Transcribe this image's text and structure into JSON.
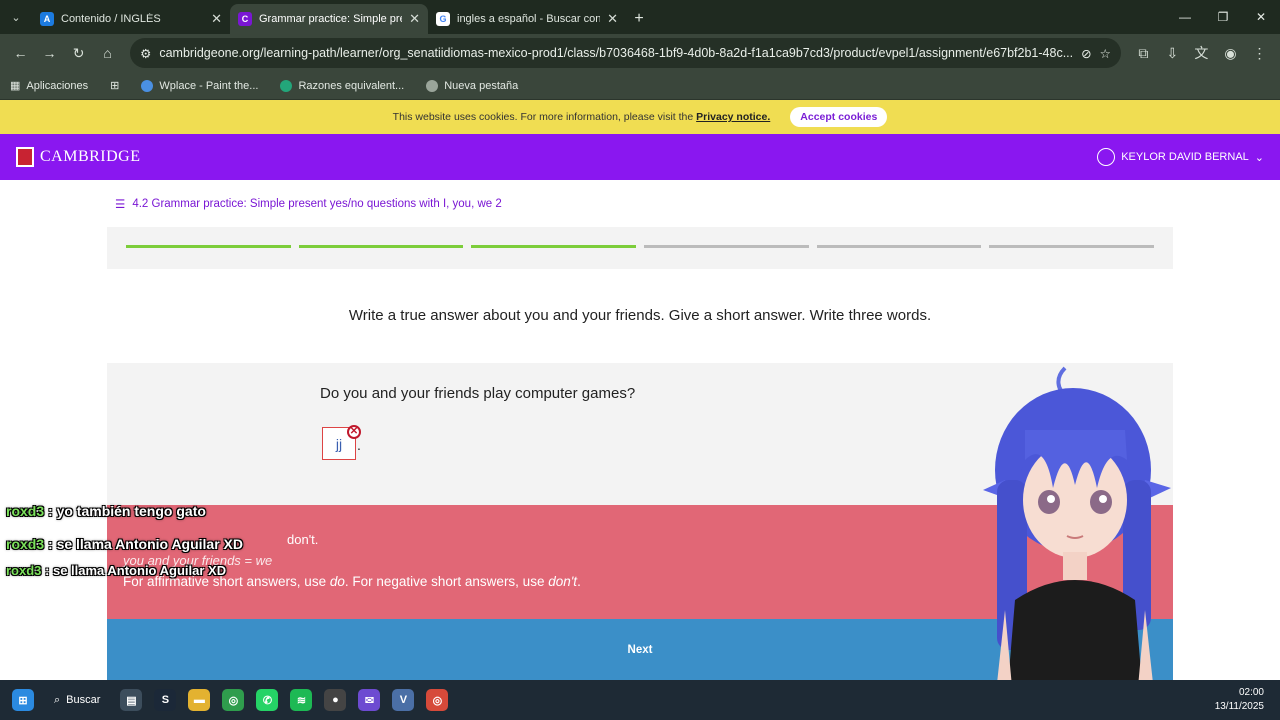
{
  "browser": {
    "tabs": [
      {
        "label": "Contenido / INGLÉS",
        "favicon": "A",
        "color": "#1c7be0"
      },
      {
        "label": "Grammar practice: Simple prese",
        "favicon": "C",
        "color": "#7a16d4"
      },
      {
        "label": "ingles a español - Buscar con G",
        "favicon": "G",
        "color": "#4285f4"
      }
    ],
    "url": "cambridgeone.org/learning-path/learner/org_senatiidiomas-mexico-prod1/class/b7036468-1bf9-4d0b-8a2d-f1a1ca9b7cd3/product/evpel1/assignment/e67bf2b1-48c...",
    "bookmarks": [
      "Aplicaciones",
      "Wplace - Paint the...",
      "Razones equivalent...",
      "Nueva pestaña"
    ]
  },
  "cookie": {
    "text": "This website uses cookies. For more information, please visit the",
    "link": "Privacy notice.",
    "button": "Accept cookies"
  },
  "header": {
    "brand": "CAMBRIDGE",
    "user": "KEYLOR DAVID BERNAL"
  },
  "lesson": {
    "breadcrumb": "4.2 Grammar practice: Simple present yes/no questions with I, you, we 2",
    "progress_done": 3,
    "progress_total": 6,
    "instruction": "Write a true answer about you and your friends. Give a short answer. Write three words.",
    "question": "Do you and your friends play computer games?",
    "answer": "jj",
    "period": ".",
    "feedback_answer": "don't.",
    "feedback_equation": "you and your friends = we",
    "feedback_rule_a": "For affirmative short answers, use ",
    "feedback_rule_do": "do",
    "feedback_rule_b": ". For negative short answers, use ",
    "feedback_rule_dont": "don't",
    "feedback_rule_c": ".",
    "next": "Next"
  },
  "chat": [
    {
      "user": "roxd3",
      "msg": " : yo también tengo gato"
    },
    {
      "user": "roxd3",
      "msg": " : se llama Antonio Aguilar XD"
    },
    {
      "user": "roxd3",
      "msg": " : se llama Antonio Aguilar XD"
    }
  ],
  "taskbar": {
    "search": "Buscar",
    "time": "02:00",
    "date": "13/11/2025"
  }
}
